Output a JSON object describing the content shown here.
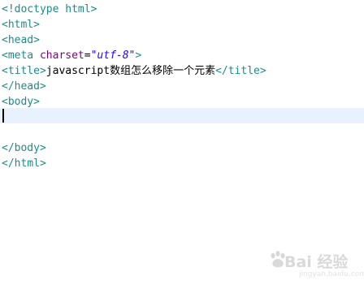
{
  "editor": {
    "lines": [
      {
        "open": "<!",
        "name": "doctype html",
        "close": ">"
      },
      {
        "open": "<",
        "name": "html",
        "close": ">"
      },
      {
        "open": "<",
        "name": "head",
        "close": ">"
      },
      {
        "open": "<",
        "name": "meta ",
        "attr": "charset",
        "eq": "=",
        "val": "\"utf-8\"",
        "close": ">"
      },
      {
        "open": "<",
        "name": "title",
        "close": ">",
        "text": "javascript数组怎么移除一个元素",
        "end_open": "</",
        "end_name": "title",
        "end_close": ">"
      },
      {
        "open": "</",
        "name": "head",
        "close": ">"
      },
      {
        "open": "<",
        "name": "body",
        "close": ">"
      },
      {
        "text": ""
      },
      {
        "text": ""
      },
      {
        "open": "</",
        "name": "body",
        "close": ">"
      },
      {
        "open": "</",
        "name": "html",
        "close": ">"
      }
    ]
  },
  "watermark": {
    "text": "Bai 经验",
    "sub": "jingyan.baidu.com"
  },
  "colors": {
    "tag": "#1f8a8a",
    "attribute": "#7f007f",
    "value": "#2a00ff",
    "current_line": "#e8f2fe"
  }
}
